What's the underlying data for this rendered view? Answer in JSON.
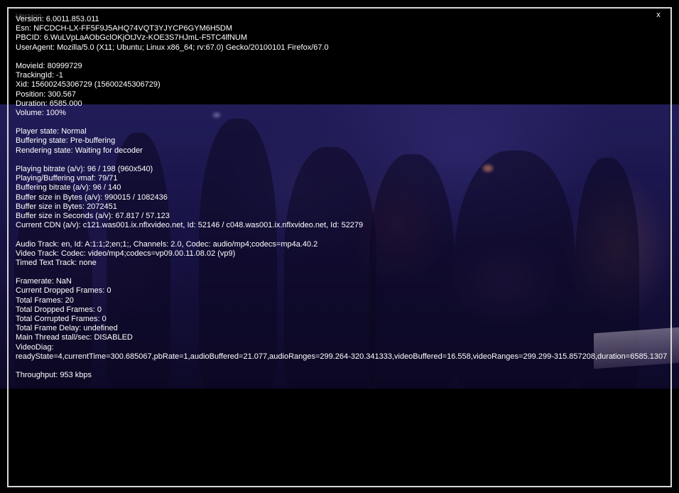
{
  "overlay": {
    "close_label": "x",
    "ghost_label": "Version",
    "groups": [
      [
        "Version: 6.0011.853.011",
        "Esn: NFCDCH-LX-FF5F9J5AHQ74VQT3YJYCP6GYM6H5DM",
        "PBCID: 6.WuLVpLaAObGclOKjOtJVz-KOE3S7HJmL-F5TC4lfNUM",
        "UserAgent: Mozilla/5.0 (X11; Ubuntu; Linux x86_64; rv:67.0) Gecko/20100101 Firefox/67.0"
      ],
      [
        "MovieId: 80999729",
        "TrackingId: -1",
        "Xid: 15600245306729 (15600245306729)",
        "Position: 300.567",
        "Duration: 6585.000",
        "Volume: 100%"
      ],
      [
        "Player state: Normal",
        "Buffering state: Pre-buffering",
        "Rendering state: Waiting for decoder"
      ],
      [
        "Playing bitrate (a/v): 96 / 198 (960x540)",
        "Playing/Buffering vmaf: 79/71",
        "Buffering bitrate (a/v): 96 / 140",
        "Buffer size in Bytes (a/v): 990015 / 1082436",
        "Buffer size in Bytes: 2072451",
        "Buffer size in Seconds (a/v): 67.817 / 57.123",
        "Current CDN (a/v): c121.was001.ix.nflxvideo.net, Id: 52146 / c048.was001.ix.nflxvideo.net, Id: 52279"
      ],
      [
        "Audio Track: en, Id: A:1:1;2;en;1;, Channels: 2.0, Codec: audio/mp4;codecs=mp4a.40.2",
        "Video Track: Codec: video/mp4;codecs=vp09.00.11.08.02 (vp9)",
        "Timed Text Track: none"
      ],
      [
        "Framerate: NaN",
        "Current Dropped Frames: 0",
        "Total Frames: 20",
        "Total Dropped Frames: 0",
        "Total Corrupted Frames: 0",
        "Total Frame Delay: undefined",
        "Main Thread stall/sec: DISABLED",
        "VideoDiag:",
        "readyState=4,currentTime=300.685067,pbRate=1,audioBuffered=21.077,audioRanges=299.264-320.341333,videoBuffered=16.558,videoRanges=299.299-315.857208,duration=6585.1307"
      ],
      [
        "Throughput: 953 kbps"
      ]
    ]
  },
  "colors": {
    "overlay_text": "#ffffff",
    "panel_border": "#d8d8d8",
    "background": "#000000",
    "video_tint": "#2a2468"
  }
}
